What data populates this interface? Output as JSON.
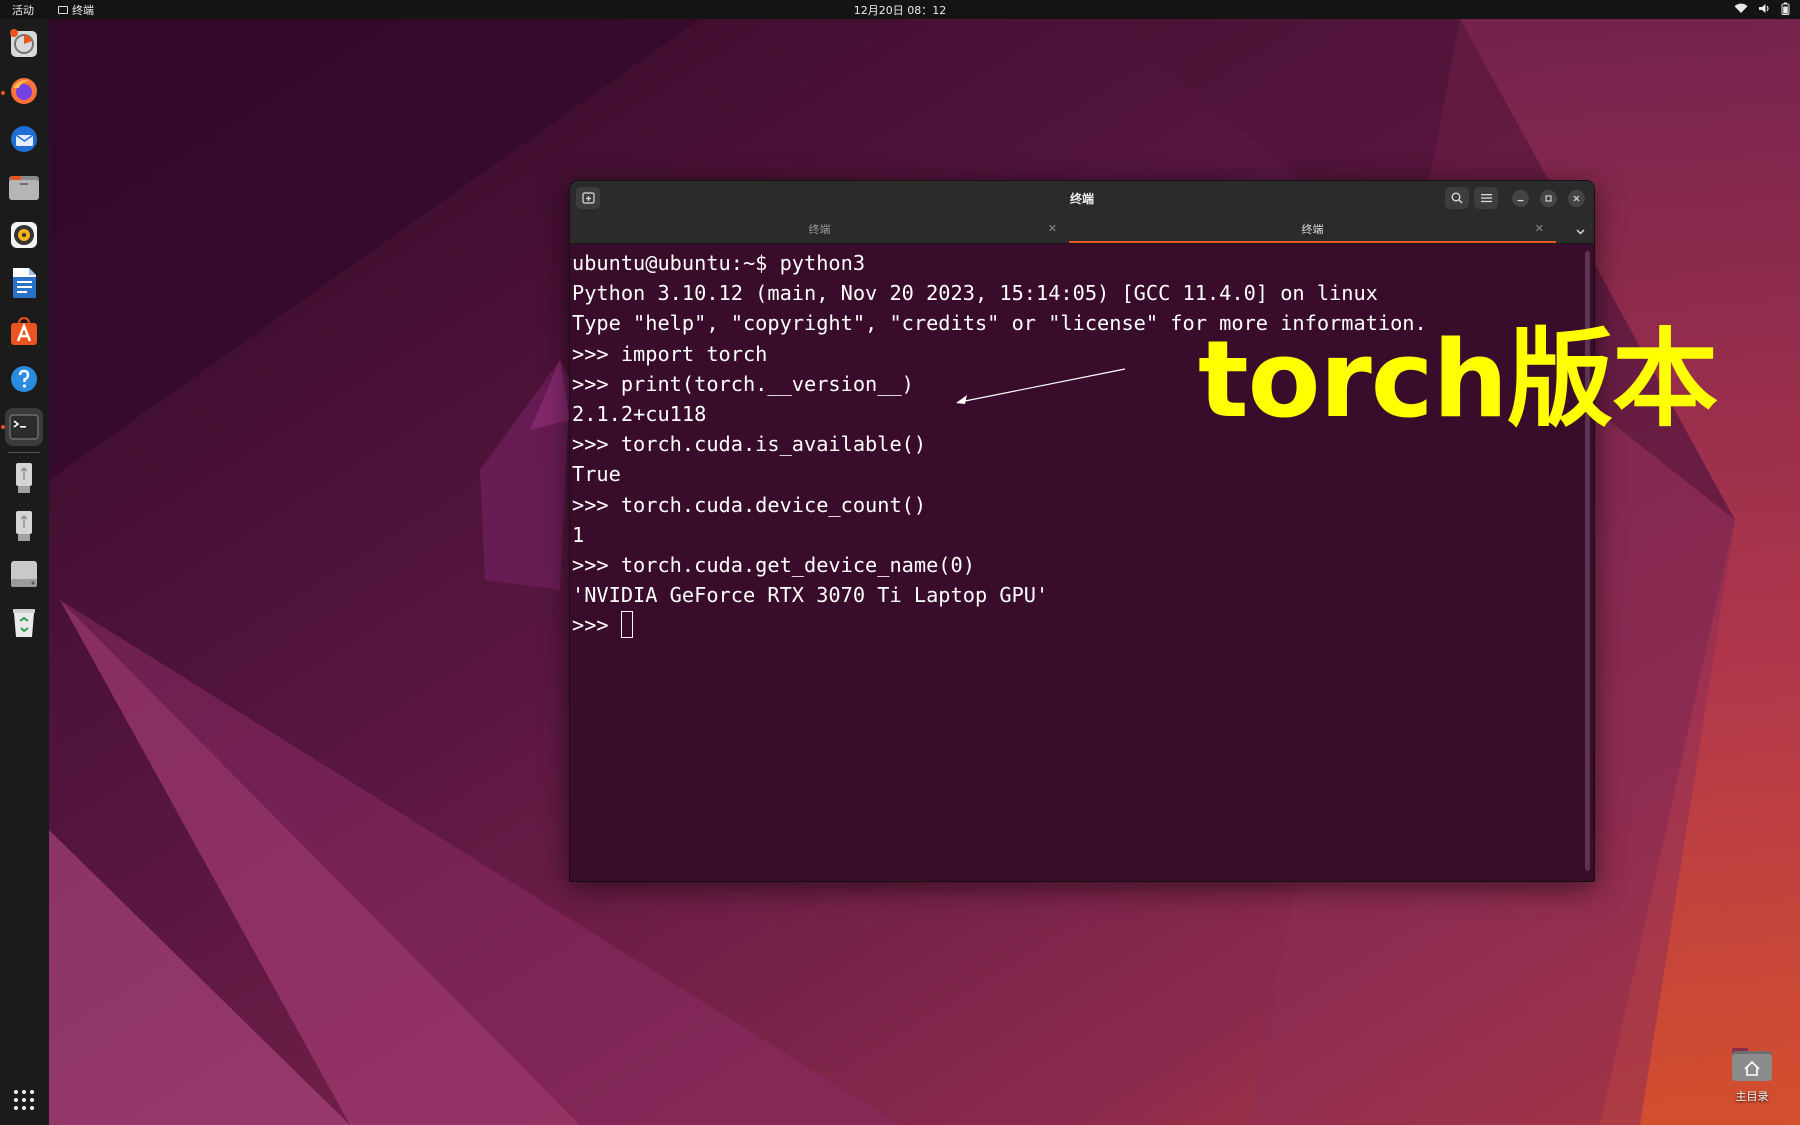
{
  "topbar": {
    "activities": "活动",
    "app_name": "终端",
    "clock": "12月20日  08：12"
  },
  "dock": {
    "apps": [
      {
        "name": "disk-usage-analyzer-icon"
      },
      {
        "name": "firefox-icon"
      },
      {
        "name": "thunderbird-icon"
      },
      {
        "name": "files-icon"
      },
      {
        "name": "rhythmbox-icon"
      },
      {
        "name": "libreoffice-writer-icon"
      },
      {
        "name": "app-center-icon"
      },
      {
        "name": "help-icon"
      },
      {
        "name": "terminal-icon"
      },
      {
        "name": "usb-drive-icon"
      },
      {
        "name": "usb-drive-icon"
      },
      {
        "name": "ssd-drive-icon"
      },
      {
        "name": "trash-icon"
      },
      {
        "name": "show-apps-grid-icon"
      }
    ]
  },
  "terminal": {
    "title": "终端",
    "tabs": [
      {
        "label": "终端",
        "active": false
      },
      {
        "label": "终端",
        "active": true
      }
    ],
    "lines": [
      "ubuntu@ubuntu:~$ python3",
      "Python 3.10.12 (main, Nov 20 2023, 15:14:05) [GCC 11.4.0] on linux",
      "Type \"help\", \"copyright\", \"credits\" or \"license\" for more information.",
      ">>> import torch",
      ">>> print(torch.__version__)",
      "2.1.2+cu118",
      ">>> torch.cuda.is_available()",
      "True",
      ">>> torch.cuda.device_count()",
      "1",
      ">>> torch.cuda.get_device_name(0)",
      "'NVIDIA GeForce RTX 3070 Ti Laptop GPU'"
    ],
    "prompt": ">>> "
  },
  "annotation": {
    "label": "torch版本",
    "color": "#ffff00"
  },
  "desktop": {
    "home_folder_label": "主目录"
  },
  "colors": {
    "terminal_bg": "#380c2a",
    "accent": "#e95420",
    "header_bg": "#2b2b2b"
  }
}
